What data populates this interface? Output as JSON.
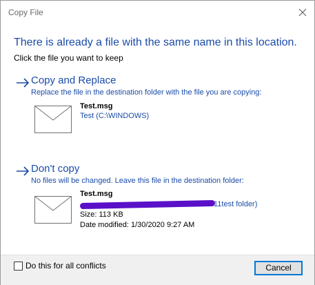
{
  "window": {
    "title": "Copy File",
    "close_icon": "close-icon"
  },
  "header": {
    "headline": "There is already a file with the same name in this location.",
    "instruction": "Click the file you want to keep"
  },
  "options": [
    {
      "title": "Copy and Replace",
      "description": "Replace the file in the destination folder with the file you are copying:",
      "icon": "arrow-right-icon",
      "file": {
        "icon": "mail-envelope-icon",
        "name": "Test.msg",
        "location": "Test (C:\\WINDOWS)"
      }
    },
    {
      "title": "Don't copy",
      "description": "No files will be changed. Leave this file in the destination folder:",
      "icon": "arrow-right-icon",
      "file": {
        "icon": "mail-envelope-icon",
        "name": "Test.msg",
        "location_visible": "11test folder)",
        "size": "Size: 113 KB",
        "date_modified": "Date modified: 1/30/2020 9:27 AM"
      }
    }
  ],
  "footer": {
    "checkbox_label": "Do this for all conflicts",
    "checkbox_checked": false,
    "cancel_label": "Cancel"
  },
  "colors": {
    "accent": "#1a4ba8",
    "redaction": "#5a10c8",
    "button_focus": "#0078d7"
  }
}
